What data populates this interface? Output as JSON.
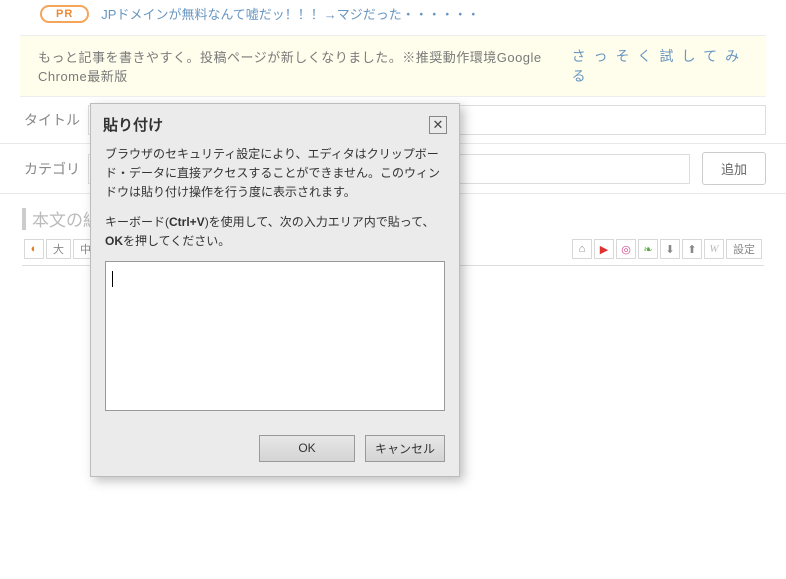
{
  "topbar": {
    "pr": "PR",
    "link": "JPドメインが無料なんて嘘だッ！！！→マジだった・・・・・・"
  },
  "notice": {
    "msg": "もっと記事を書きやすく。投稿ページが新しくなりました。※推奨動作環境Google Chrome最新版",
    "try": "さっそく試してみる"
  },
  "rows": {
    "title": "タイトル",
    "category": "カテゴリ",
    "add": "追加"
  },
  "section": {
    "title": "本文の編"
  },
  "toolbar": {
    "items": [
      "",
      "大",
      "中",
      "",
      "",
      "",
      "",
      "",
      "",
      "",
      "",
      "",
      "",
      "",
      "",
      "",
      "",
      "",
      "",
      "",
      "設定"
    ],
    "tv": "⌂",
    "yt": "▶",
    "ig": "◎",
    "ever": "❧",
    "down": "⬇",
    "up": "⬆",
    "w": "W"
  },
  "modal": {
    "title": "貼り付け",
    "p1": "ブラウザのセキュリティ設定により、エディタはクリップボード・データに直接アクセスすることができません。このウィンドウは貼り付け操作を行う度に表示されます。",
    "p2a": "キーボード(",
    "p2b": "Ctrl+V",
    "p2c": ")を使用して、次の入力エリア内で貼って、",
    "p2d": "OK",
    "p2e": "を押してください。",
    "ok": "OK",
    "cancel": "キャンセル"
  }
}
